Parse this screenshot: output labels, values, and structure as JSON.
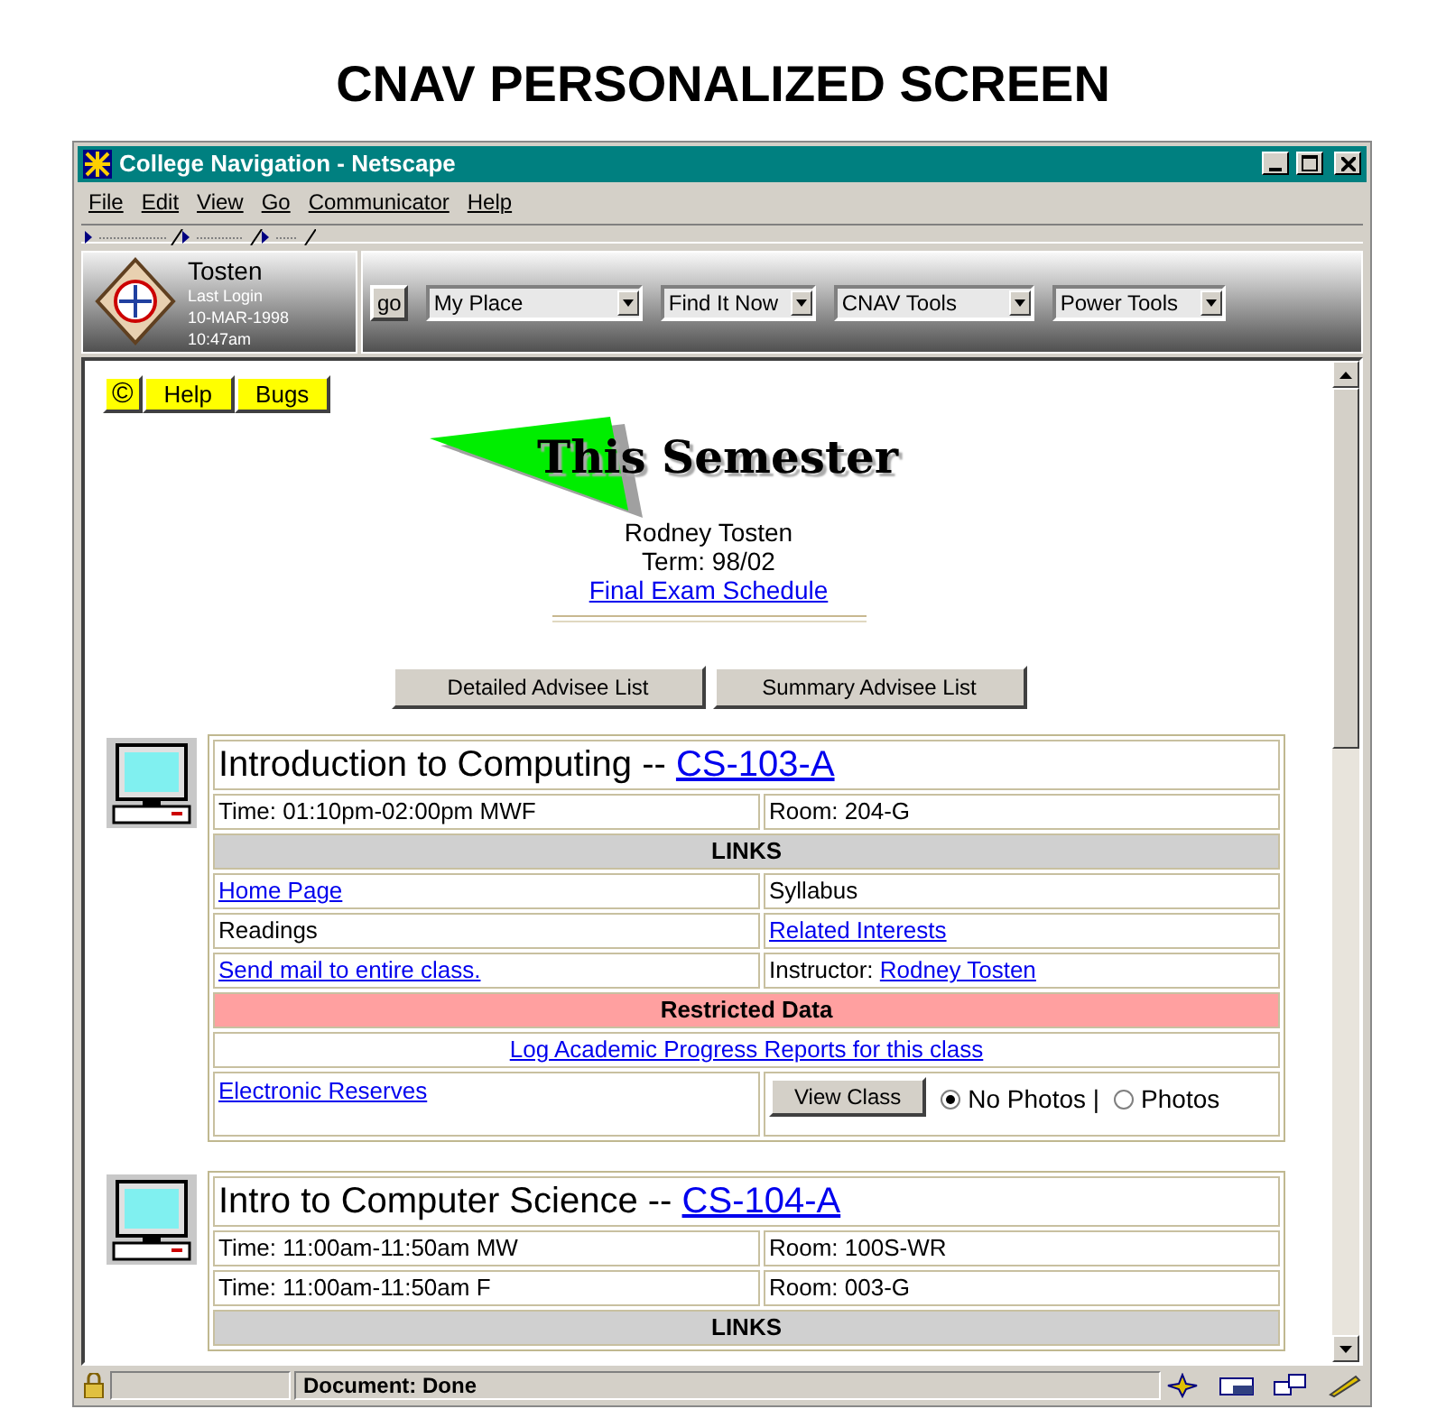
{
  "heading": "CNAV PERSONALIZED SCREEN",
  "window": {
    "title": "College Navigation - Netscape"
  },
  "menu": [
    "File",
    "Edit",
    "View",
    "Go",
    "Communicator",
    "Help"
  ],
  "user_panel": {
    "name": "Tosten",
    "last_login_label": "Last Login",
    "date": "10-MAR-1998",
    "time": "10:47am"
  },
  "toolbar": {
    "go": "go",
    "dropdowns": [
      "My Place",
      "Find It Now",
      "CNAV Tools",
      "Power Tools"
    ]
  },
  "quick_buttons": [
    "©",
    "Help",
    "Bugs"
  ],
  "banner": "This Semester",
  "profile": {
    "name": "Rodney Tosten",
    "term": "Term: 98/02",
    "link": "Final Exam Schedule"
  },
  "advisee_buttons": [
    "Detailed Advisee List",
    "Summary Advisee List"
  ],
  "courses": [
    {
      "title": "Introduction to Computing --",
      "code": "CS-103-A",
      "times": [
        {
          "time": "Time: 01:10pm-02:00pm MWF",
          "room": "Room: 204-G"
        }
      ],
      "links_header": "LINKS",
      "links": [
        {
          "kind": "link",
          "text": "Home Page"
        },
        {
          "kind": "text",
          "text": "Syllabus"
        },
        {
          "kind": "text",
          "text": "Readings"
        },
        {
          "kind": "link",
          "text": "Related Interests"
        },
        {
          "kind": "link",
          "text": "Send mail to entire class."
        },
        {
          "kind": "instructor",
          "label": "Instructor:",
          "text": "Rodney Tosten"
        }
      ],
      "restricted": {
        "header": "Restricted Data",
        "log_link": "Log Academic Progress Reports for this class",
        "reserves_link": "Electronic Reserves",
        "view_button": "View Class",
        "photo_options": [
          {
            "label": "No Photos |",
            "selected": true
          },
          {
            "label": "Photos",
            "selected": false
          }
        ]
      }
    },
    {
      "title": "Intro to Computer Science --",
      "code": "CS-104-A",
      "times": [
        {
          "time": "Time: 11:00am-11:50am MW",
          "room": "Room: 100S-WR"
        },
        {
          "time": "Time: 11:00am-11:50am F",
          "room": "Room: 003-G"
        }
      ],
      "links_header": "LINKS"
    }
  ],
  "status_bar": {
    "text": "Document: Done"
  }
}
